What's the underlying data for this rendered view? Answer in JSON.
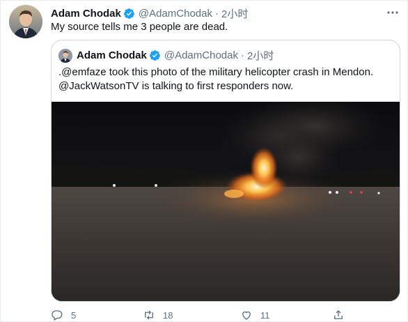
{
  "tweet": {
    "author_name": "Adam Chodak",
    "author_handle": "@AdamChodak",
    "separator": "·",
    "time": "2小时",
    "text": "My source tells me 3 people are dead."
  },
  "quoted": {
    "author_name": "Adam Chodak",
    "author_handle": "@AdamChodak",
    "separator": "·",
    "time": "2小时",
    "lines": [
      ".@emfaze took this photo of the military helicopter crash in Mendon.",
      "@JackWatsonTV is talking to first responders now."
    ]
  },
  "actions": {
    "reply_count": "5",
    "retweet_count": "18",
    "like_count": "11"
  },
  "colors": {
    "text": "#0f1419",
    "secondary": "#5b7083",
    "verified": "#1da1f2",
    "border": "#cfd9de"
  },
  "icons": [
    "verified-badge-icon",
    "more-icon",
    "reply-icon",
    "retweet-icon",
    "like-icon",
    "share-icon"
  ]
}
